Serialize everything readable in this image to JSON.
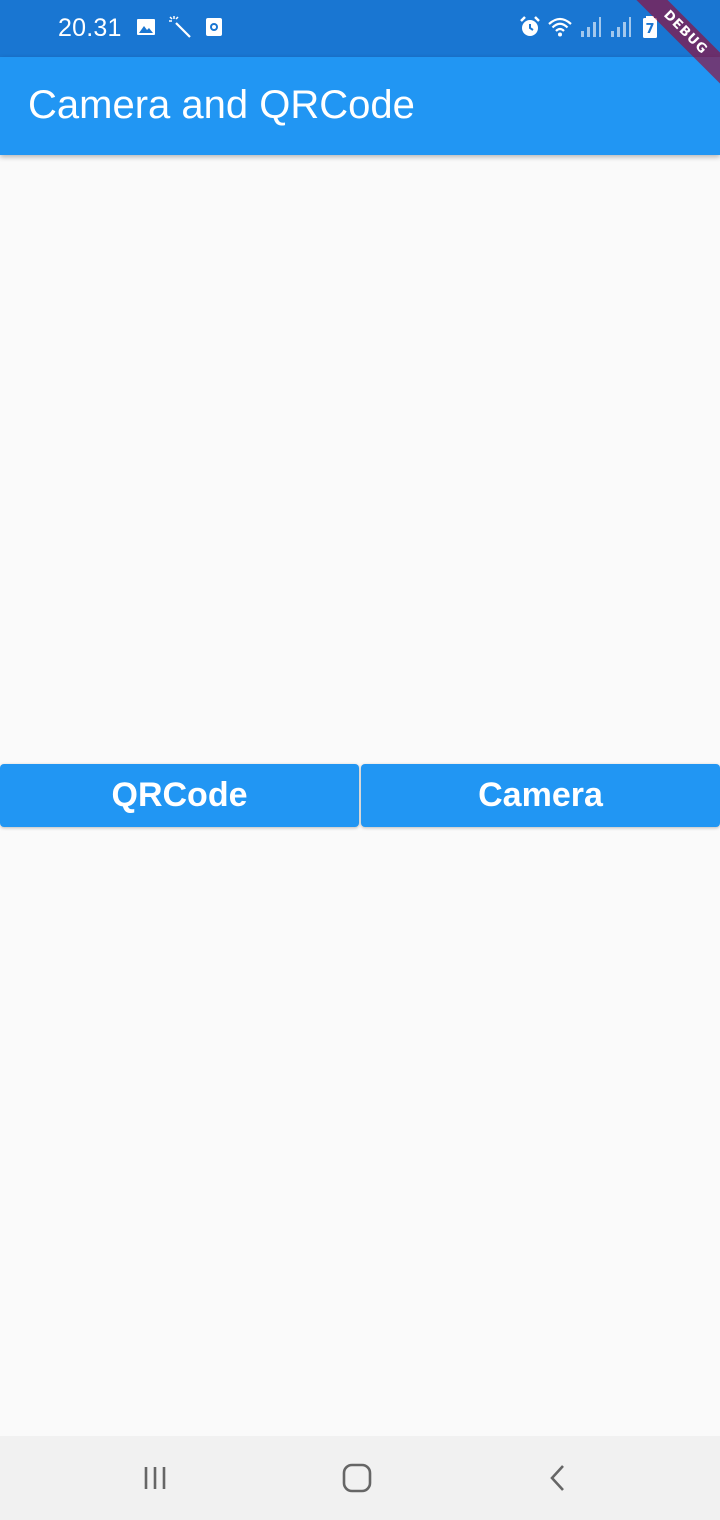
{
  "status_bar": {
    "time": "20.31",
    "left_icons": [
      "image-icon",
      "magic-wand-icon",
      "camera-app-icon"
    ],
    "right_icons": [
      "alarm-icon",
      "wifi-icon",
      "signal-icon",
      "signal-icon",
      "battery-icon"
    ],
    "battery_text": "7"
  },
  "debug_banner": "DEBUG",
  "app_bar": {
    "title": "Camera and QRCode",
    "color": "#2196f3"
  },
  "buttons": {
    "qrcode_label": "QRCode",
    "camera_label": "Camera"
  },
  "nav_bar": {
    "icons": [
      "recent-apps-icon",
      "home-icon",
      "back-icon"
    ]
  }
}
